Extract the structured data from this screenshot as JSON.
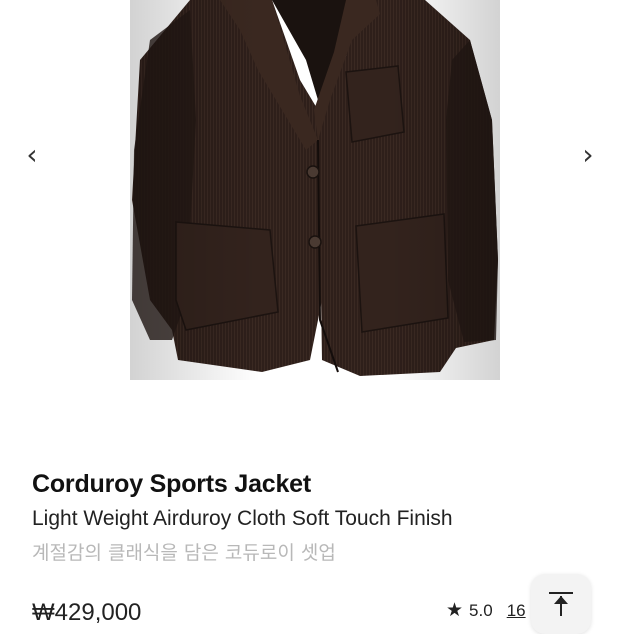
{
  "gallery": {
    "prev_icon": "chevron-left-icon",
    "next_icon": "chevron-right-icon",
    "prev_glyph": "‹",
    "next_glyph": "›"
  },
  "product": {
    "name": "Corduroy Sports Jacket",
    "subtitle": "Light Weight Airduroy Cloth Soft Touch Finish",
    "korean_desc": "계절감의 클래식을 담은 코듀로이 셋업",
    "price": "₩429,000",
    "rating": "5.0",
    "review_count": "16"
  },
  "icons": {
    "star": "star-icon",
    "scroll_top": "arrow-up-to-top-icon"
  },
  "colors": {
    "jacket": "#2e1f1a",
    "korean_text": "#b8b8b8"
  }
}
